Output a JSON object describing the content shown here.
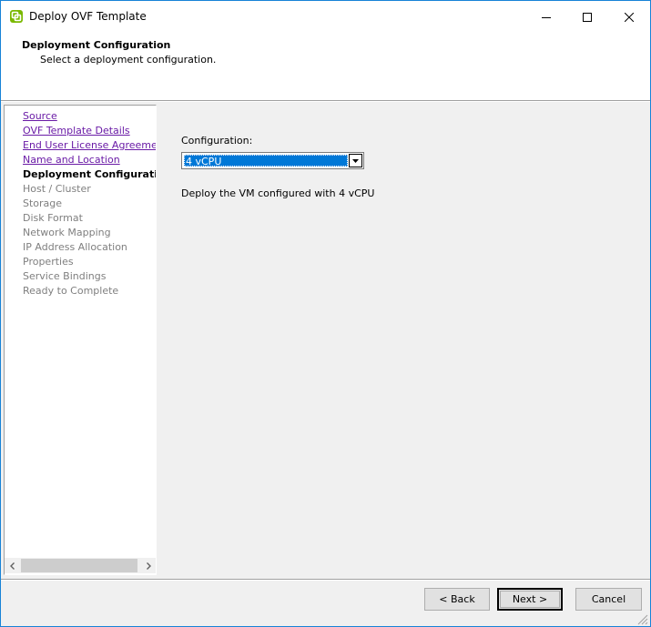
{
  "window": {
    "title": "Deploy OVF Template"
  },
  "header": {
    "title": "Deployment Configuration",
    "subtitle": "Select a deployment configuration."
  },
  "steps": [
    {
      "label": "Source",
      "state": "done"
    },
    {
      "label": "OVF Template Details",
      "state": "done"
    },
    {
      "label": "End User License Agreement",
      "state": "done"
    },
    {
      "label": "Name and Location",
      "state": "done"
    },
    {
      "label": "Deployment Configuration",
      "state": "current"
    },
    {
      "label": "Host / Cluster",
      "state": "pending"
    },
    {
      "label": "Storage",
      "state": "pending"
    },
    {
      "label": "Disk Format",
      "state": "pending"
    },
    {
      "label": "Network Mapping",
      "state": "pending"
    },
    {
      "label": "IP Address Allocation",
      "state": "pending"
    },
    {
      "label": "Properties",
      "state": "pending"
    },
    {
      "label": "Service Bindings",
      "state": "pending"
    },
    {
      "label": "Ready to Complete",
      "state": "pending"
    }
  ],
  "main": {
    "config_label": "Configuration:",
    "config_selected": "4 vCPU",
    "description": "Deploy the VM configured with 4 vCPU"
  },
  "footer": {
    "back_label": "< Back",
    "next_label": "Next >",
    "cancel_label": "Cancel"
  },
  "colors": {
    "window_border": "#1883d7",
    "link_visited": "#6a1ba6",
    "selection": "#0078d7",
    "panel_bg": "#f0f0f0"
  }
}
